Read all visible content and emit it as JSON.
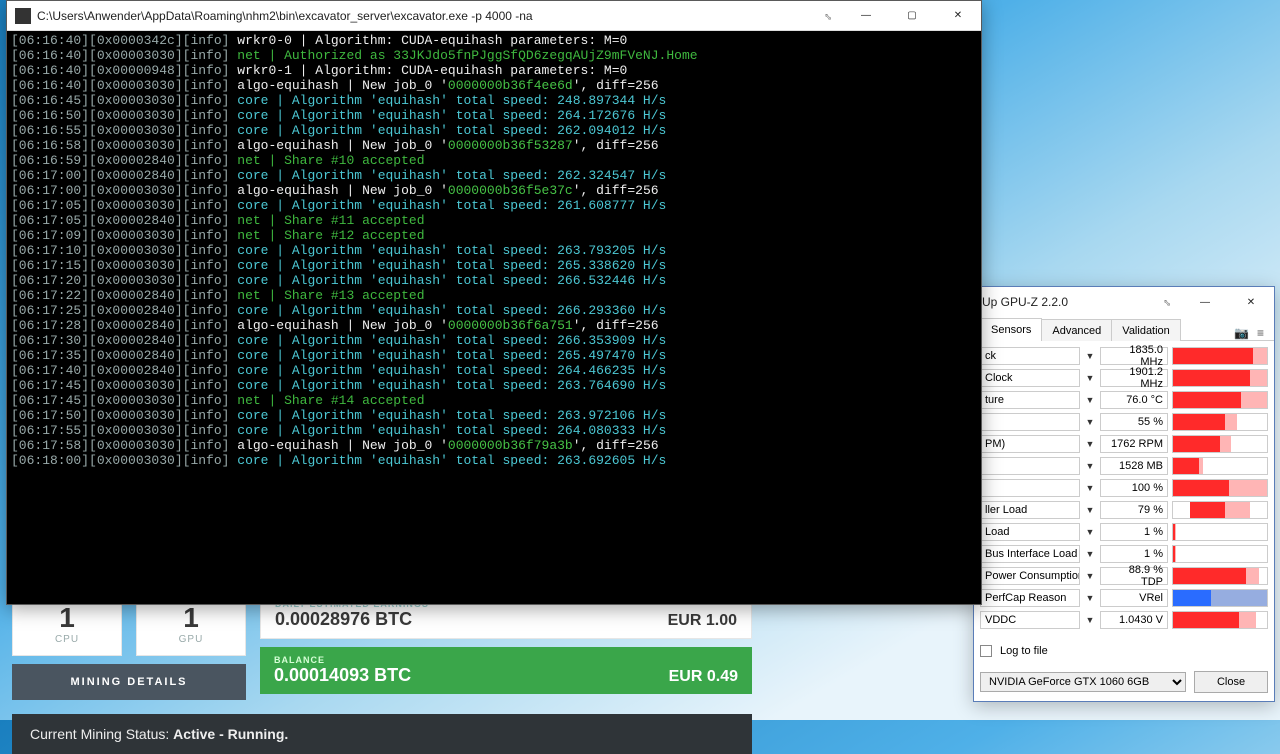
{
  "console": {
    "title": "C:\\Users\\Anwender\\AppData\\Roaming\\nhm2\\bin\\excavator_server\\excavator.exe  -p 4000 -na",
    "lines": [
      {
        "ts": "06:16:40",
        "thr": "0x0000342c",
        "msg_type": "wrkr",
        "text": "wrkr0-0 | Algorithm: CUDA-equihash parameters: M=0"
      },
      {
        "ts": "06:16:40",
        "thr": "0x00003030",
        "msg_type": "net",
        "text": "net | Authorized as 33JKJdo5fnPJggSfQD6zegqAUjZ9mFVeNJ.Home"
      },
      {
        "ts": "06:16:40",
        "thr": "0x00000948",
        "msg_type": "wrkr",
        "text": "wrkr0-1 | Algorithm: CUDA-equihash parameters: M=0"
      },
      {
        "ts": "06:16:40",
        "thr": "0x00003030",
        "msg_type": "job",
        "job": "0000000b36f4ee6d",
        "diff": "256"
      },
      {
        "ts": "06:16:45",
        "thr": "0x00003030",
        "msg_type": "speed",
        "speed": "248.897344"
      },
      {
        "ts": "06:16:50",
        "thr": "0x00003030",
        "msg_type": "speed",
        "speed": "264.172676"
      },
      {
        "ts": "06:16:55",
        "thr": "0x00003030",
        "msg_type": "speed",
        "speed": "262.094012"
      },
      {
        "ts": "06:16:58",
        "thr": "0x00003030",
        "msg_type": "job",
        "job": "0000000b36f53287",
        "diff": "256"
      },
      {
        "ts": "06:16:59",
        "thr": "0x00002840",
        "msg_type": "share",
        "share": "10"
      },
      {
        "ts": "06:17:00",
        "thr": "0x00002840",
        "msg_type": "speed",
        "speed": "262.324547"
      },
      {
        "ts": "06:17:00",
        "thr": "0x00003030",
        "msg_type": "job",
        "job": "0000000b36f5e37c",
        "diff": "256"
      },
      {
        "ts": "06:17:05",
        "thr": "0x00003030",
        "msg_type": "speed",
        "speed": "261.608777"
      },
      {
        "ts": "06:17:05",
        "thr": "0x00002840",
        "msg_type": "share",
        "share": "11"
      },
      {
        "ts": "06:17:09",
        "thr": "0x00003030",
        "msg_type": "share",
        "share": "12"
      },
      {
        "ts": "06:17:10",
        "thr": "0x00003030",
        "msg_type": "speed",
        "speed": "263.793205"
      },
      {
        "ts": "06:17:15",
        "thr": "0x00003030",
        "msg_type": "speed",
        "speed": "265.338620"
      },
      {
        "ts": "06:17:20",
        "thr": "0x00003030",
        "msg_type": "speed",
        "speed": "266.532446"
      },
      {
        "ts": "06:17:22",
        "thr": "0x00002840",
        "msg_type": "share",
        "share": "13"
      },
      {
        "ts": "06:17:25",
        "thr": "0x00002840",
        "msg_type": "speed",
        "speed": "266.293360"
      },
      {
        "ts": "06:17:28",
        "thr": "0x00002840",
        "msg_type": "job",
        "job": "0000000b36f6a751",
        "diff": "256"
      },
      {
        "ts": "06:17:30",
        "thr": "0x00002840",
        "msg_type": "speed",
        "speed": "266.353909"
      },
      {
        "ts": "06:17:35",
        "thr": "0x00002840",
        "msg_type": "speed",
        "speed": "265.497470"
      },
      {
        "ts": "06:17:40",
        "thr": "0x00002840",
        "msg_type": "speed",
        "speed": "264.466235"
      },
      {
        "ts": "06:17:45",
        "thr": "0x00003030",
        "msg_type": "speed",
        "speed": "263.764690"
      },
      {
        "ts": "06:17:45",
        "thr": "0x00003030",
        "msg_type": "share",
        "share": "14"
      },
      {
        "ts": "06:17:50",
        "thr": "0x00003030",
        "msg_type": "speed",
        "speed": "263.972106"
      },
      {
        "ts": "06:17:55",
        "thr": "0x00003030",
        "msg_type": "speed",
        "speed": "264.080333"
      },
      {
        "ts": "06:17:58",
        "thr": "0x00003030",
        "msg_type": "job",
        "job": "0000000b36f79a3b",
        "diff": "256"
      },
      {
        "ts": "06:18:00",
        "thr": "0x00003030",
        "msg_type": "speed",
        "speed": "263.692605"
      }
    ]
  },
  "miner": {
    "cpu_count": "1",
    "cpu_label": "CPU",
    "gpu_count": "1",
    "gpu_label": "GPU",
    "daily_title": "DAILY ESTIMATED EARNINGS",
    "daily_btc": "0.00028976 BTC",
    "daily_eur": "EUR 1.00",
    "balance_title": "BALANCE",
    "balance_btc": "0.00014093 BTC",
    "balance_eur": "EUR 0.49",
    "details_btn": "MINING DETAILS",
    "status_prefix": "Current Mining Status: ",
    "status_value": "Active - Running."
  },
  "gpuz": {
    "title": "Up GPU-Z 2.2.0",
    "tabs": [
      "Sensors",
      "Advanced",
      "Validation"
    ],
    "sensors": [
      {
        "name": "ck",
        "value": "1835.0 MHz",
        "fill": 85,
        "fill2": 100,
        "color": "#ff2a2a"
      },
      {
        "name": "Clock",
        "value": "1901.2 MHz",
        "fill": 82,
        "fill2": 100,
        "color": "#ff2a2a"
      },
      {
        "name": "ture",
        "value": "76.0 °C",
        "fill": 72,
        "fill2": 100,
        "color": "#ff2a2a"
      },
      {
        "name": "",
        "value": "55 %",
        "fill": 55,
        "fill2": 68,
        "color": "#ff2a2a"
      },
      {
        "name": "PM)",
        "value": "1762 RPM",
        "fill": 50,
        "fill2": 62,
        "color": "#ff2a2a"
      },
      {
        "name": "",
        "value": "1528 MB",
        "fill": 28,
        "fill2": 32,
        "color": "#ff2a2a"
      },
      {
        "name": "",
        "value": "100 %",
        "fill": 60,
        "fill2": 100,
        "color": "#ff2a2a",
        "offset": true
      },
      {
        "name": "ller Load",
        "value": "79 %",
        "fill": 55,
        "fill2": 82,
        "color": "#ff2a2a",
        "offset": true
      },
      {
        "name": "Load",
        "value": "1 %",
        "fill": 2,
        "fill2": 3,
        "color": "#ff2a2a"
      },
      {
        "name": "Bus Interface Load",
        "value": "1 %",
        "fill": 2,
        "fill2": 3,
        "color": "#ff2a2a"
      },
      {
        "name": "Power Consumption",
        "value": "88.9 % TDP",
        "fill": 78,
        "fill2": 92,
        "color": "#ff2a2a"
      },
      {
        "name": "PerfCap Reason",
        "value": "VRel",
        "fill": 40,
        "fill2": 100,
        "color": "#2a6cff",
        "bg": "#d0d0d0"
      },
      {
        "name": "VDDC",
        "value": "1.0430 V",
        "fill": 70,
        "fill2": 88,
        "color": "#ff2a2a"
      }
    ],
    "log_label": "Log to file",
    "gpu_select": "NVIDIA GeForce GTX 1060 6GB",
    "close_btn": "Close"
  }
}
